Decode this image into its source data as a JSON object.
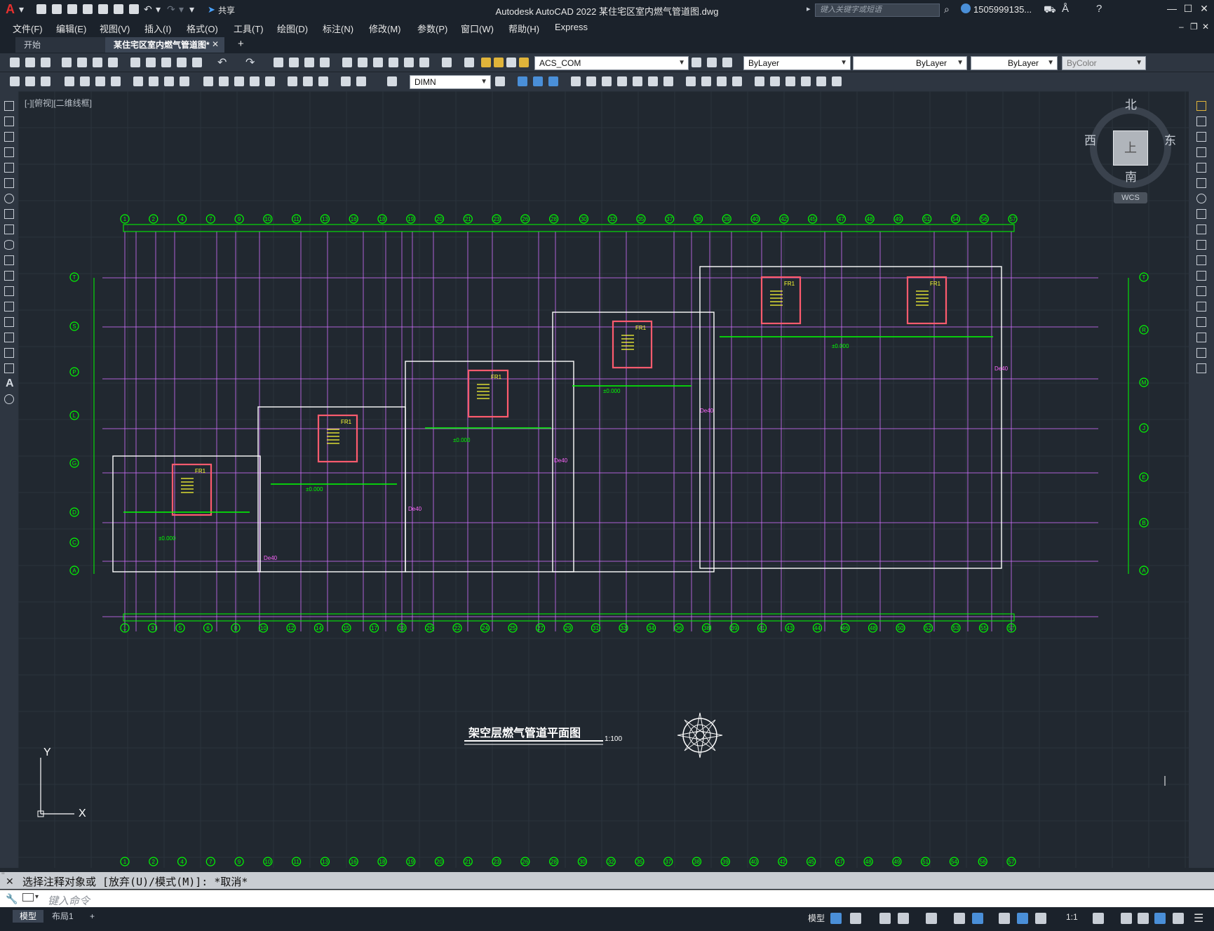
{
  "app": {
    "title": "Autodesk AutoCAD 2022    某住宅区室内燃气管道图.dwg",
    "share_label": "共享",
    "search_placeholder": "键入关键字或短语",
    "user": "1505999135..."
  },
  "menu": [
    "文件(F)",
    "编辑(E)",
    "视图(V)",
    "插入(I)",
    "格式(O)",
    "工具(T)",
    "绘图(D)",
    "标注(N)",
    "修改(M)",
    "参数(P)",
    "窗口(W)",
    "帮助(H)",
    "Express"
  ],
  "tabs": {
    "start": "开始",
    "doc": "某住宅区室内燃气管道图*",
    "add": "+"
  },
  "toolbar": {
    "layer": "ACS_COM",
    "color": "ByLayer",
    "linetype": "ByLayer",
    "lineweight": "ByLayer",
    "plotstyle": "ByColor",
    "dimstyle": "DIMN"
  },
  "viewport_label": "[-][俯视][二维线框]",
  "viewcube": {
    "north": "北",
    "south": "南",
    "east": "东",
    "west": "西",
    "top": "上",
    "wcs": "WCS"
  },
  "drawing": {
    "title": "架空层燃气管道平面图",
    "scale": "1:100",
    "top_axes": [
      "1",
      "2",
      "4",
      "7",
      "9",
      "10",
      "11",
      "13",
      "16",
      "18",
      "19",
      "20",
      "21",
      "23",
      "26",
      "28",
      "30",
      "32",
      "35",
      "37",
      "38",
      "39",
      "40",
      "42",
      "45",
      "47",
      "48",
      "49",
      "51",
      "54",
      "56",
      "57"
    ],
    "bottom_axes": [
      "1",
      "3",
      "5",
      "6",
      "8",
      "10",
      "12",
      "14",
      "15",
      "17",
      "19",
      "20",
      "22",
      "24",
      "25",
      "27",
      "29",
      "31",
      "33",
      "34",
      "36",
      "38",
      "39",
      "41",
      "43",
      "44",
      "46",
      "48",
      "50",
      "52",
      "53",
      "55",
      "57"
    ],
    "left_axes": [
      "T",
      "S",
      "P",
      "L",
      "G",
      "D",
      "C",
      "A"
    ],
    "right_axes": [
      "T",
      "R",
      "M",
      "J",
      "E",
      "B",
      "A"
    ],
    "riser_label": "FR1",
    "pipe_label": "De40",
    "elev_label": "±0.000"
  },
  "command": {
    "history": "选择注释对象或 [放弃(U)/模式(M)]: *取消*",
    "placeholder": "键入命令"
  },
  "status": {
    "model_tab": "模型",
    "layout_tab": "布局1",
    "add": "+",
    "model_btn": "模型",
    "scale": "1:1"
  },
  "colors": {
    "grid_green": "#00ff00",
    "axis_magenta": "#d070ff",
    "wall_white": "#ffffff",
    "wall_red": "#ff5b6e",
    "accent_yellow": "#ffff33"
  }
}
